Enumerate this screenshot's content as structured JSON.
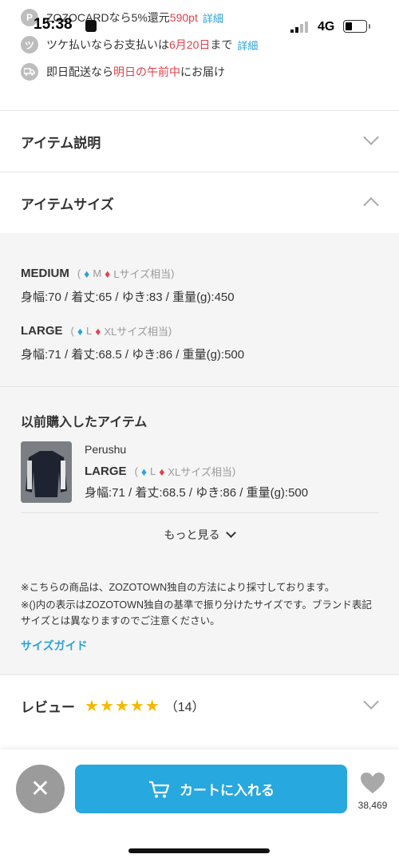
{
  "status_bar": {
    "time": "15:38",
    "network": "4G"
  },
  "promos": [
    {
      "icon_text": "P",
      "icon_name": "points-icon",
      "before": "ZOZOCARDなら5%還元 ",
      "highlight": "590pt",
      "after": "",
      "link": "詳細"
    },
    {
      "icon_text": "ツ",
      "icon_name": "tsuke-icon",
      "before": "ツケ払いならお支払いは",
      "highlight": "6月20日",
      "after": "まで",
      "link": "詳細"
    },
    {
      "icon_text": "▭",
      "icon_name": "truck-icon",
      "before": "即日配送なら",
      "highlight": "明日の午前中",
      "after": "にお届け",
      "link": ""
    }
  ],
  "accordion": {
    "description_title": "アイテム説明",
    "size_title": "アイテムサイズ"
  },
  "sizes": [
    {
      "name": "MEDIUM",
      "men": "M",
      "women": "Lサイズ相当",
      "measurements": "身幅:70 / 着丈:65 / ゆき:83 / 重量(g):450"
    },
    {
      "name": "LARGE",
      "men": "L",
      "women": "XLサイズ相当",
      "measurements": "身幅:71 / 着丈:68.5 / ゆき:86 / 重量(g):500"
    }
  ],
  "previous_purchase": {
    "title": "以前購入したアイテム",
    "brand": "Perushu",
    "size": "LARGE",
    "men": "L",
    "women": "XLサイズ相当",
    "measurements": "身幅:71 / 着丈:68.5 / ゆき:86 / 重量(g):500"
  },
  "more_label": "もっと見る",
  "notes": [
    "※こちらの商品は、ZOZOTOWN独自の方法により採寸しております。",
    "※()内の表示はZOZOTOWN独自の基準で振り分けたサイズです。ブランド表記サイズとは異なりますのでご注意ください。"
  ],
  "size_guide": "サイズガイド",
  "review": {
    "title": "レビュー",
    "rating": 5,
    "count": "（14）"
  },
  "bottom_bar": {
    "cart_label": "カートに入れる",
    "fav_count": "38,469"
  },
  "colors": {
    "accent_blue": "#27a8de",
    "price_red": "#e0424b",
    "star": "#f5b800"
  }
}
